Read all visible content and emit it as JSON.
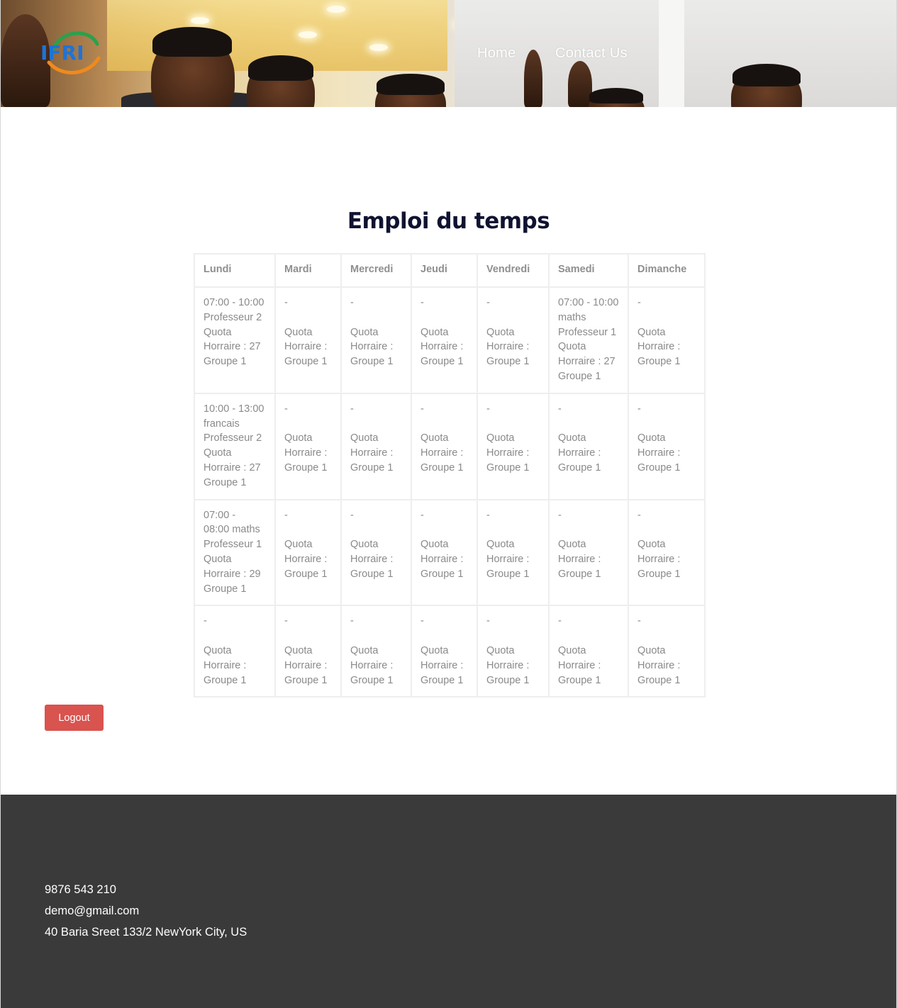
{
  "header": {
    "logo_text": "IFRI",
    "nav": [
      {
        "label": "Home"
      },
      {
        "label": "Contact Us"
      }
    ]
  },
  "main": {
    "title": "Emploi du temps",
    "table": {
      "columns": [
        "Lundi",
        "Mardi",
        "Mercredi",
        "Jeudi",
        "Vendredi",
        "Samedi",
        "Dimanche"
      ],
      "rows": [
        [
          [
            "07:00 - 10:00",
            "Professeur 2",
            "Quota",
            "Horraire : 27",
            "Groupe 1"
          ],
          [
            "-",
            "",
            "Quota",
            "Horraire :",
            "Groupe 1"
          ],
          [
            "-",
            "",
            "Quota",
            "Horraire :",
            "Groupe 1"
          ],
          [
            "-",
            "",
            "Quota",
            "Horraire :",
            "Groupe 1"
          ],
          [
            "-",
            "",
            "Quota",
            "Horraire :",
            "Groupe 1"
          ],
          [
            "07:00 - 10:00",
            "maths",
            "Professeur 1",
            "Quota",
            "Horraire : 27",
            "Groupe 1"
          ],
          [
            "-",
            "",
            "Quota",
            "Horraire :",
            "Groupe 1"
          ]
        ],
        [
          [
            "10:00 - 13:00",
            "francais",
            "Professeur 2",
            "Quota",
            "Horraire : 27",
            "Groupe 1"
          ],
          [
            "-",
            "",
            "Quota",
            "Horraire :",
            "Groupe 1"
          ],
          [
            "-",
            "",
            "Quota",
            "Horraire :",
            "Groupe 1"
          ],
          [
            "-",
            "",
            "Quota",
            "Horraire :",
            "Groupe 1"
          ],
          [
            "-",
            "",
            "Quota",
            "Horraire :",
            "Groupe 1"
          ],
          [
            "-",
            "",
            "Quota",
            "Horraire :",
            "Groupe 1"
          ],
          [
            "-",
            "",
            "Quota",
            "Horraire :",
            "Groupe 1"
          ]
        ],
        [
          [
            "07:00 -",
            "08:00 maths",
            "Professeur 1",
            "Quota",
            "Horraire : 29",
            "Groupe 1"
          ],
          [
            "-",
            "",
            "Quota",
            "Horraire :",
            "Groupe 1"
          ],
          [
            "-",
            "",
            "Quota",
            "Horraire :",
            "Groupe 1"
          ],
          [
            "-",
            "",
            "Quota",
            "Horraire :",
            "Groupe 1"
          ],
          [
            "-",
            "",
            "Quota",
            "Horraire :",
            "Groupe 1"
          ],
          [
            "-",
            "",
            "Quota",
            "Horraire :",
            "Groupe 1"
          ],
          [
            "-",
            "",
            "Quota",
            "Horraire :",
            "Groupe 1"
          ]
        ],
        [
          [
            "-",
            "",
            "Quota",
            "Horraire :",
            "Groupe 1"
          ],
          [
            "-",
            "",
            "Quota",
            "Horraire :",
            "Groupe 1"
          ],
          [
            "-",
            "",
            "Quota",
            "Horraire :",
            "Groupe 1"
          ],
          [
            "-",
            "",
            "Quota",
            "Horraire :",
            "Groupe 1"
          ],
          [
            "-",
            "",
            "Quota",
            "Horraire :",
            "Groupe 1"
          ],
          [
            "-",
            "",
            "Quota",
            "Horraire :",
            "Groupe 1"
          ],
          [
            "-",
            "",
            "Quota",
            "Horraire :",
            "Groupe 1"
          ]
        ]
      ]
    },
    "logout_label": "Logout"
  },
  "footer": {
    "phone": "9876 543 210",
    "email": "demo@gmail.com",
    "address": "40 Baria Sreet 133/2 NewYork City, US"
  },
  "colors": {
    "title": "#0f1330",
    "table_text": "#8a8a8a",
    "logout_bg": "#d9534f",
    "footer_bg": "#3a3a3a"
  }
}
